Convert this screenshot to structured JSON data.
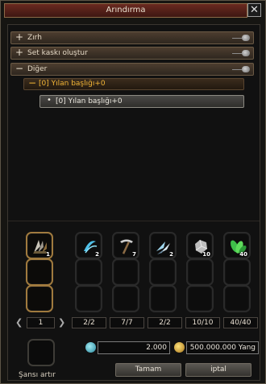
{
  "window": {
    "title": "Arındırma",
    "close_glyph": "✕"
  },
  "tree": {
    "categories": [
      {
        "sign": "+",
        "label": "Zırh"
      },
      {
        "sign": "+",
        "label": "Set kaskı oluştur"
      },
      {
        "sign": "−",
        "label": "Diğer"
      }
    ],
    "subcategory": {
      "sign": "−",
      "label": "[0] Yılan başlığı+0"
    },
    "leaf": {
      "bullet": "•",
      "label": "[0] Yılan başlığı+0"
    }
  },
  "main_item": {
    "icon": "claw-helmet-icon",
    "count": "1",
    "page": "1"
  },
  "materials": [
    {
      "icon": "blue-crescent-icon",
      "count": "2",
      "ratio": "2/2"
    },
    {
      "icon": "pickaxe-icon",
      "count": "7",
      "ratio": "7/7"
    },
    {
      "icon": "claw-blade-icon",
      "count": "2",
      "ratio": "2/2"
    },
    {
      "icon": "silver-ore-icon",
      "count": "10",
      "ratio": "10/10"
    },
    {
      "icon": "green-leaves-icon",
      "count": "40",
      "ratio": "40/40"
    }
  ],
  "chance": {
    "label": "Şansı artır"
  },
  "cost": {
    "points": "2.000",
    "yang": "500.000.000 Yang"
  },
  "buttons": {
    "ok": "Tamam",
    "cancel": "iptal"
  },
  "colors": {
    "accent": "#f2b536",
    "title_bar": "#5a241c"
  }
}
